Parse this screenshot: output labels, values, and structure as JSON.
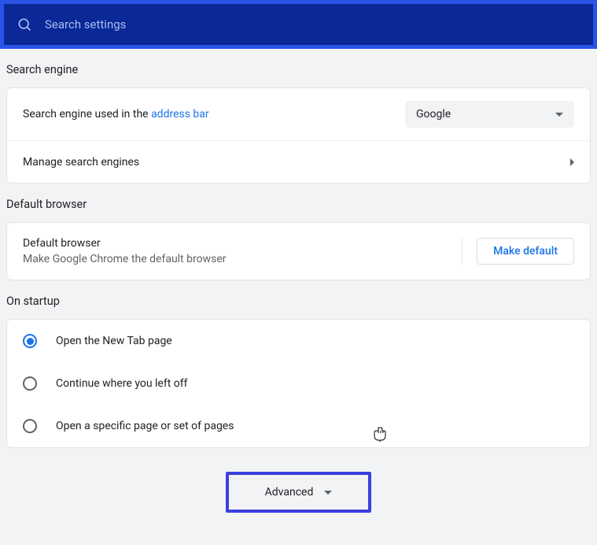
{
  "search": {
    "placeholder": "Search settings"
  },
  "sections": {
    "searchEngine": {
      "title": "Search engine",
      "row1_prefix": "Search engine used in the ",
      "row1_link": "address bar",
      "selected": "Google",
      "row2": "Manage search engines"
    },
    "defaultBrowser": {
      "title": "Default browser",
      "row_title": "Default browser",
      "row_sub": "Make Google Chrome the default browser",
      "button": "Make default"
    },
    "onStartup": {
      "title": "On startup",
      "options": [
        "Open the New Tab page",
        "Continue where you left off",
        "Open a specific page or set of pages"
      ],
      "selected_index": 0
    }
  },
  "advanced": {
    "label": "Advanced"
  }
}
